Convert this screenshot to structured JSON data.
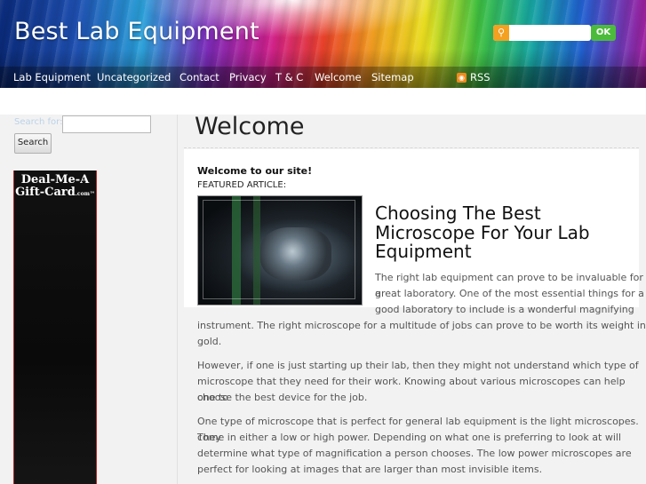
{
  "header": {
    "site_title": "Best Lab Equipment",
    "search_button": "OK"
  },
  "nav": {
    "items": [
      "Lab Equipment",
      "Uncategorized",
      "Contact",
      "Privacy",
      "T & C",
      "Welcome",
      "Sitemap"
    ],
    "rss": "RSS"
  },
  "sidebar": {
    "search_label": "Search for:",
    "search_button": "Search",
    "ad_line1": "Deal-Me-A",
    "ad_line2": "Gift-Card",
    "ad_suffix": ".com™"
  },
  "main": {
    "page_title": "Welcome",
    "welcome": "Welcome to our site!",
    "featured_label": "FEATURED ARTICLE:",
    "article_title": "Choosing The Best Microscope For Your Lab Equipment",
    "p1_side": [
      "The right lab equipment can prove to be invaluable for a",
      "great laboratory. One of the most essential things for a",
      "good laboratory to include is a wonderful magnifying"
    ],
    "p1_full": [
      "instrument. The right microscope for a multitude of jobs can prove to be worth its weight in",
      "gold."
    ],
    "p2": [
      "However, if one is just starting up their lab, then they might not understand which type of",
      "microscope that they need for their work. Knowing about various microscopes can help one to",
      "choose the best device for the job."
    ],
    "p3": [
      "One type of microscope that is perfect for general lab equipment is the light microscopes. They",
      "come in either a low or high power. Depending on what one is preferring to look at will",
      "determine what type of magnification a person chooses. The low power microscopes are",
      "perfect for looking at images that are larger than most invisible items."
    ]
  }
}
